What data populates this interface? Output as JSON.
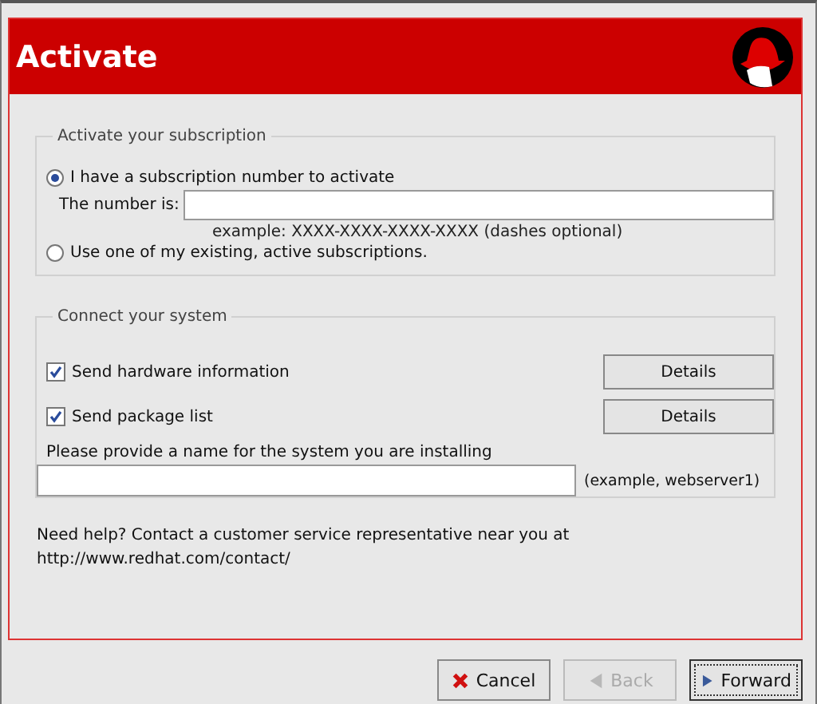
{
  "header": {
    "title": "Activate"
  },
  "subscription_group": {
    "legend": "Activate your subscription",
    "options": [
      {
        "label": "I have a subscription number to activate",
        "selected": true
      },
      {
        "label": "Use one of my existing, active subscriptions.",
        "selected": false
      }
    ],
    "number_label": "The number is:",
    "number_hint": "example: XXXX-XXXX-XXXX-XXXX (dashes optional)"
  },
  "connect_group": {
    "legend": "Connect your system",
    "checks": [
      {
        "label": "Send hardware information",
        "checked": true,
        "button": "Details"
      },
      {
        "label": "Send package list",
        "checked": true,
        "button": "Details"
      }
    ],
    "name_label": "Please provide a name for the system you are installing",
    "name_hint": "(example, webserver1)"
  },
  "help": {
    "text": "Need help? Contact a customer service representative near you at",
    "link": "http://www.redhat.com/contact/"
  },
  "buttons": [
    {
      "kind": "cancel",
      "label": "Cancel",
      "disabled": false,
      "focused": false
    },
    {
      "kind": "back",
      "label": "Back",
      "disabled": true,
      "focused": false
    },
    {
      "kind": "forward",
      "label": "Forward",
      "disabled": false,
      "focused": true
    }
  ]
}
